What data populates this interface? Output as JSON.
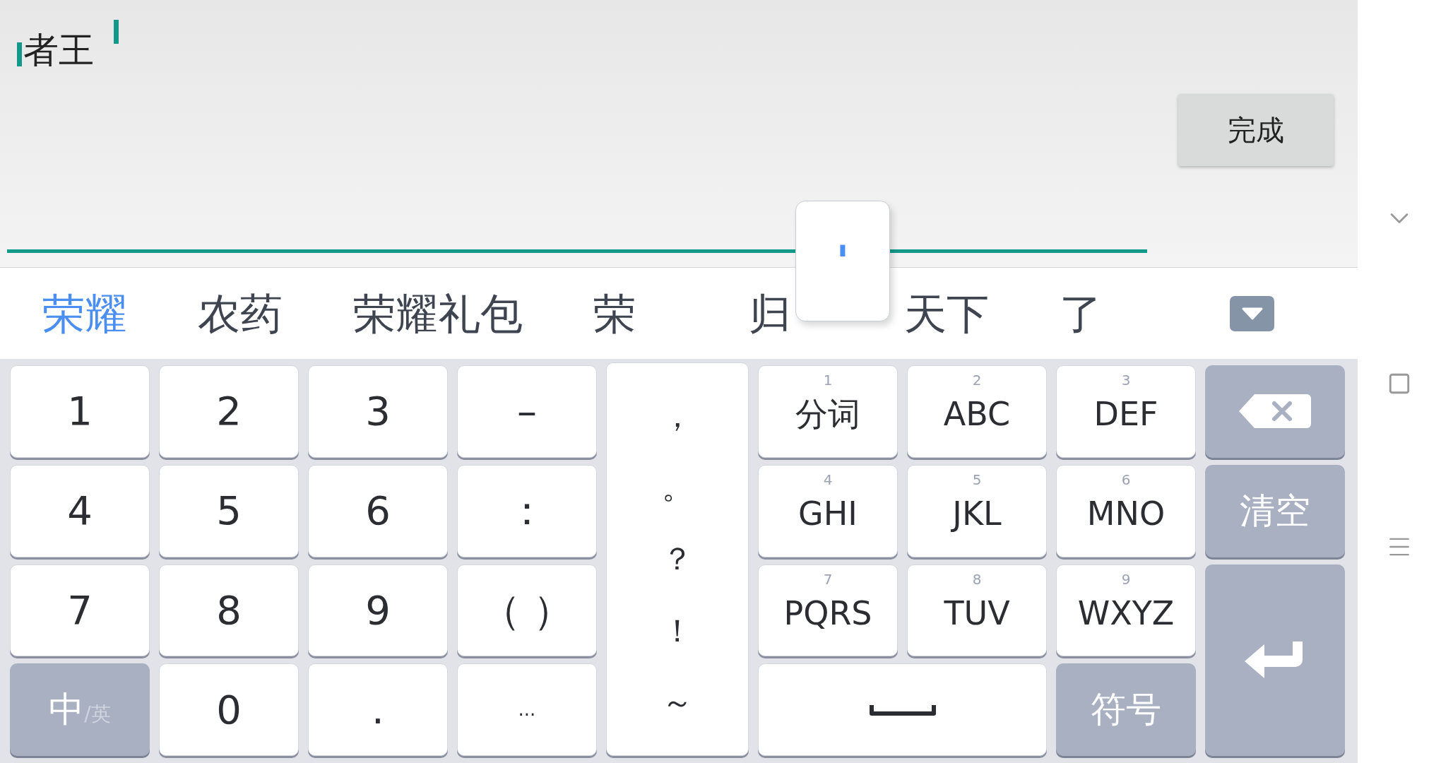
{
  "input": {
    "value": "者王"
  },
  "done_button": "完成",
  "key_preview": "'",
  "candidates": [
    {
      "text": "荣耀",
      "selected": true
    },
    {
      "text": "农药",
      "selected": false
    },
    {
      "text": "荣耀礼包",
      "selected": false
    },
    {
      "text": "荣",
      "selected": false
    },
    {
      "text": "归",
      "selected": false
    },
    {
      "text": "天下",
      "selected": false
    },
    {
      "text": "了",
      "selected": false
    }
  ],
  "keys": [
    {
      "kind": "digit",
      "label": "1"
    },
    {
      "kind": "digit",
      "label": "2"
    },
    {
      "kind": "digit",
      "label": "3"
    },
    {
      "kind": "digit",
      "label": "–"
    },
    {
      "kind": "punct_column",
      "items": [
        "，",
        "。",
        "？",
        "！",
        "～"
      ]
    },
    {
      "kind": "letters",
      "number": "1",
      "label": "分词"
    },
    {
      "kind": "letters",
      "number": "2",
      "label": "ABC"
    },
    {
      "kind": "letters",
      "number": "3",
      "label": "DEF"
    },
    {
      "kind": "backspace"
    },
    {
      "kind": "digit",
      "label": "4"
    },
    {
      "kind": "digit",
      "label": "5"
    },
    {
      "kind": "digit",
      "label": "6"
    },
    {
      "kind": "digit",
      "label": "："
    },
    {
      "kind": "letters",
      "number": "4",
      "label": "GHI"
    },
    {
      "kind": "letters",
      "number": "5",
      "label": "JKL"
    },
    {
      "kind": "letters",
      "number": "6",
      "label": "MNO"
    },
    {
      "kind": "function",
      "label": "清空"
    },
    {
      "kind": "digit",
      "label": "7"
    },
    {
      "kind": "digit",
      "label": "8"
    },
    {
      "kind": "digit",
      "label": "9"
    },
    {
      "kind": "digit",
      "label": "（ ）"
    },
    {
      "kind": "letters",
      "number": "7",
      "label": "PQRS"
    },
    {
      "kind": "letters",
      "number": "8",
      "label": "TUV"
    },
    {
      "kind": "letters",
      "number": "9",
      "label": "WXYZ"
    },
    {
      "kind": "enter"
    },
    {
      "kind": "lang",
      "primary": "中",
      "secondary": "/英"
    },
    {
      "kind": "digit",
      "label": "0"
    },
    {
      "kind": "digit",
      "label": "."
    },
    {
      "kind": "small",
      "label": "..."
    },
    {
      "kind": "space"
    },
    {
      "kind": "function",
      "label": "符号"
    }
  ]
}
